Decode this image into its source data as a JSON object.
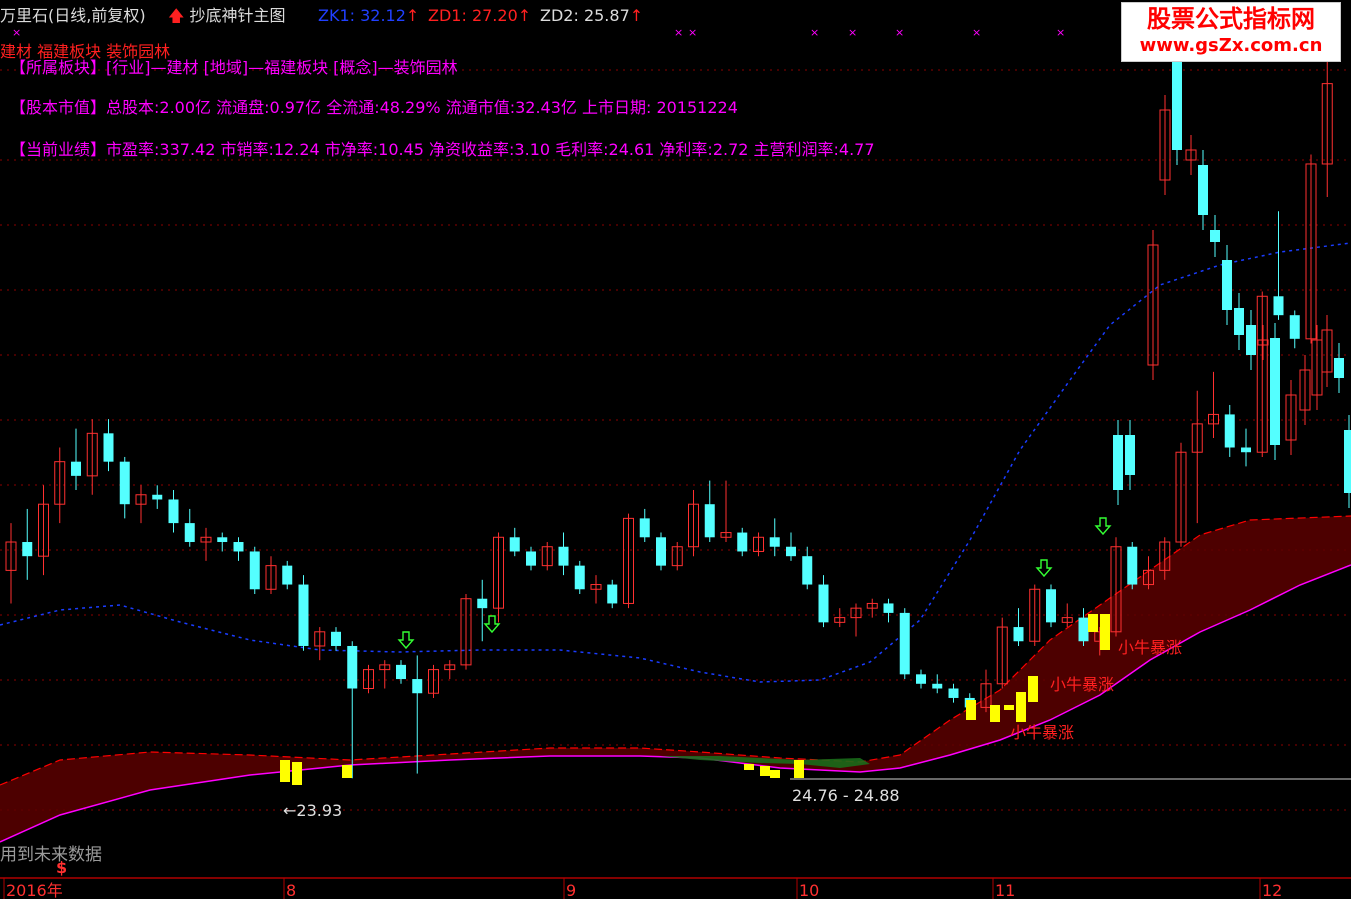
{
  "header": {
    "stock_title": "万里石(日线,前复权)",
    "indicator_name": "抄底神针主图",
    "zk1_label": "ZK1: 32.12",
    "zd1_label": "ZD1: 27.20",
    "zd2_label": "ZD2: 25.87"
  },
  "sector_line": "建材 福建板块 装饰园林",
  "info": {
    "board_key": "【所属板块】",
    "board_val": "[行业]—建材 [地域]—福建板块 [概念]—装饰园林",
    "cap_key": "【股本市值】",
    "cap_val": "总股本:2.00亿 流通盘:0.97亿 全流通:48.29% 流通市值:32.43亿 上市日期: 20151224",
    "perf_key": "【当前业绩】",
    "perf_val": "市盈率:337.42 市销率:12.24 市净率:10.45 净资收益率:3.10 毛利率:24.61 净利率:2.72 主营利润率:4.77"
  },
  "brand": {
    "line1": "股票公式指标网",
    "line2": "www.gsZx.com.cn"
  },
  "bottom_note": "用到未来数据",
  "dollar_mark": "$",
  "chart_data": {
    "type": "candlestick",
    "x_axis_labels": [
      "2016年",
      "8",
      "9",
      "10",
      "11",
      "12"
    ],
    "annotations": {
      "low_label": "←23.93",
      "range_label": "24.76 - 24.88",
      "signal_text": "小牛暴涨"
    },
    "colors": {
      "up": "#ff3030",
      "down": "#54ffff",
      "signal": "#ffff00",
      "ma_dotted": "#1a3cff",
      "band_fill": "#5a0000",
      "band_line": "#ff0000",
      "lower_line": "#ff00ff",
      "arrow": "#33ff33",
      "grid": "#8b0000"
    },
    "candles": [
      [
        28.6,
        29.6,
        27.9,
        29.2
      ],
      [
        29.2,
        29.9,
        28.4,
        28.9
      ],
      [
        28.9,
        30.4,
        28.5,
        30.0
      ],
      [
        30.0,
        31.2,
        29.6,
        30.9
      ],
      [
        30.9,
        31.6,
        30.3,
        30.6
      ],
      [
        30.6,
        31.8,
        30.2,
        31.5
      ],
      [
        31.5,
        31.8,
        30.7,
        30.9
      ],
      [
        30.9,
        31.0,
        29.7,
        30.0
      ],
      [
        30.0,
        30.4,
        29.6,
        30.2
      ],
      [
        30.2,
        30.4,
        29.9,
        30.1
      ],
      [
        30.1,
        30.3,
        29.4,
        29.6
      ],
      [
        29.6,
        29.9,
        29.1,
        29.2
      ],
      [
        29.2,
        29.5,
        28.8,
        29.3
      ],
      [
        29.3,
        29.4,
        29.0,
        29.2
      ],
      [
        29.2,
        29.3,
        28.8,
        29.0
      ],
      [
        29.0,
        29.1,
        28.1,
        28.2
      ],
      [
        28.2,
        28.9,
        28.1,
        28.7
      ],
      [
        28.7,
        28.8,
        28.2,
        28.3
      ],
      [
        28.3,
        28.5,
        26.9,
        27.0
      ],
      [
        27.0,
        27.4,
        26.7,
        27.3
      ],
      [
        27.3,
        27.4,
        26.9,
        27.0
      ],
      [
        27.0,
        27.1,
        24.2,
        26.1
      ],
      [
        26.1,
        26.6,
        26.0,
        26.5
      ],
      [
        26.5,
        26.7,
        26.1,
        26.6
      ],
      [
        26.6,
        26.7,
        26.2,
        26.3
      ],
      [
        26.3,
        26.8,
        24.3,
        26.0
      ],
      [
        26.0,
        26.6,
        25.9,
        26.5
      ],
      [
        26.5,
        26.7,
        26.3,
        26.6
      ],
      [
        26.6,
        28.1,
        26.5,
        28.0
      ],
      [
        28.0,
        28.4,
        27.1,
        27.8
      ],
      [
        27.8,
        29.4,
        27.5,
        29.3
      ],
      [
        29.3,
        29.5,
        28.9,
        29.0
      ],
      [
        29.0,
        29.1,
        28.6,
        28.7
      ],
      [
        28.7,
        29.2,
        28.6,
        29.1
      ],
      [
        29.1,
        29.4,
        28.5,
        28.7
      ],
      [
        28.7,
        28.8,
        28.1,
        28.2
      ],
      [
        28.2,
        28.5,
        27.9,
        28.3
      ],
      [
        28.3,
        28.4,
        27.8,
        27.9
      ],
      [
        27.9,
        29.8,
        27.8,
        29.7
      ],
      [
        29.7,
        29.9,
        29.2,
        29.3
      ],
      [
        29.3,
        29.4,
        28.6,
        28.7
      ],
      [
        28.7,
        29.2,
        28.6,
        29.1
      ],
      [
        29.1,
        30.3,
        28.9,
        30.0
      ],
      [
        30.0,
        30.5,
        29.2,
        29.3
      ],
      [
        29.3,
        30.5,
        29.2,
        29.4
      ],
      [
        29.4,
        29.5,
        28.9,
        29.0
      ],
      [
        29.0,
        29.4,
        28.9,
        29.3
      ],
      [
        29.3,
        29.7,
        28.9,
        29.1
      ],
      [
        29.1,
        29.4,
        28.8,
        28.9
      ],
      [
        28.9,
        29.1,
        28.2,
        28.3
      ],
      [
        28.3,
        28.5,
        27.4,
        27.5
      ],
      [
        27.5,
        27.8,
        27.4,
        27.6
      ],
      [
        27.6,
        27.9,
        27.2,
        27.8
      ],
      [
        27.8,
        28.0,
        27.6,
        27.9
      ],
      [
        27.9,
        28.0,
        27.5,
        27.7
      ],
      [
        27.7,
        27.8,
        26.3,
        26.4
      ],
      [
        26.4,
        26.5,
        26.1,
        26.2
      ],
      [
        26.2,
        26.4,
        26.0,
        26.1
      ],
      [
        26.1,
        26.2,
        25.8,
        25.9
      ],
      [
        25.9,
        26.0,
        25.6,
        25.7
      ],
      [
        25.7,
        26.5,
        25.6,
        26.2
      ],
      [
        26.2,
        27.6,
        26.1,
        27.4
      ],
      [
        27.4,
        27.8,
        27.0,
        27.1
      ],
      [
        27.1,
        28.3,
        27.0,
        28.2
      ],
      [
        28.2,
        28.3,
        27.4,
        27.5
      ],
      [
        27.5,
        27.9,
        27.4,
        27.6
      ],
      [
        27.6,
        27.8,
        27.0,
        27.1
      ],
      [
        27.1,
        27.4,
        26.8,
        27.3
      ],
      [
        27.3,
        29.3,
        27.2,
        29.1
      ],
      [
        29.1,
        29.2,
        28.2,
        28.3
      ],
      [
        28.3,
        28.9,
        28.2,
        28.6
      ],
      [
        28.6,
        29.3,
        28.4,
        29.2
      ],
      [
        29.2,
        31.3,
        29.1,
        31.1
      ],
      [
        31.1,
        32.4,
        29.6,
        31.7
      ],
      [
        31.7,
        32.8,
        31.4,
        31.9
      ],
      [
        31.9,
        32.1,
        31.0,
        31.2
      ],
      [
        31.2,
        31.6,
        30.8,
        31.1
      ],
      [
        31.1,
        34.5,
        31.0,
        34.4
      ],
      [
        34.4,
        36.2,
        33.9,
        34.0
      ],
      [
        34.0,
        34.1,
        33.3,
        33.5
      ],
      [
        33.5,
        37.4,
        33.4,
        37.2
      ],
      [
        37.2,
        39.4,
        36.5,
        38.9
      ]
    ]
  }
}
